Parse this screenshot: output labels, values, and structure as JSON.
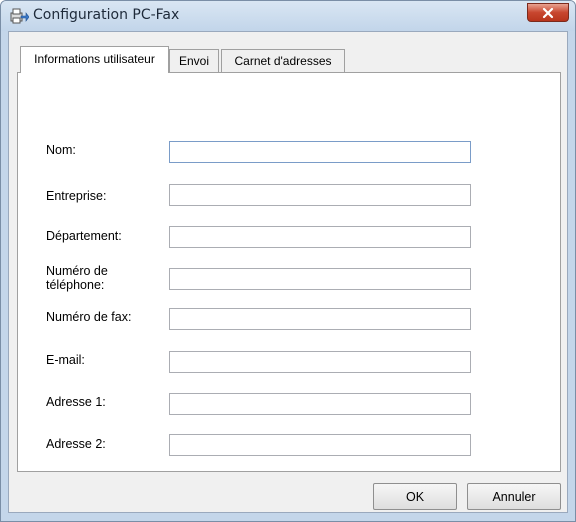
{
  "window": {
    "title": "Configuration PC-Fax",
    "icon": "fax-printer-icon"
  },
  "tabs": [
    {
      "label": "Informations utilisateur",
      "active": true
    },
    {
      "label": "Envoi",
      "active": false
    },
    {
      "label": "Carnet d'adresses",
      "active": false
    }
  ],
  "form": {
    "name_label": "Nom:",
    "name_value": "",
    "company_label": "Entreprise:",
    "company_value": "",
    "department_label": "Département:",
    "department_value": "",
    "phone_label_line1": "Numéro de",
    "phone_label_line2": "téléphone:",
    "phone_value": "",
    "fax_label": "Numéro de fax:",
    "fax_value": "",
    "email_label": "E-mail:",
    "email_value": "",
    "address1_label": "Adresse 1:",
    "address1_value": "",
    "address2_label": "Adresse 2:",
    "address2_value": ""
  },
  "buttons": {
    "ok": "OK",
    "cancel": "Annuler"
  },
  "colors": {
    "close_button": "#c8462f",
    "window_frame": "#c4d6ea",
    "dialog_face": "#f0f0f0"
  }
}
